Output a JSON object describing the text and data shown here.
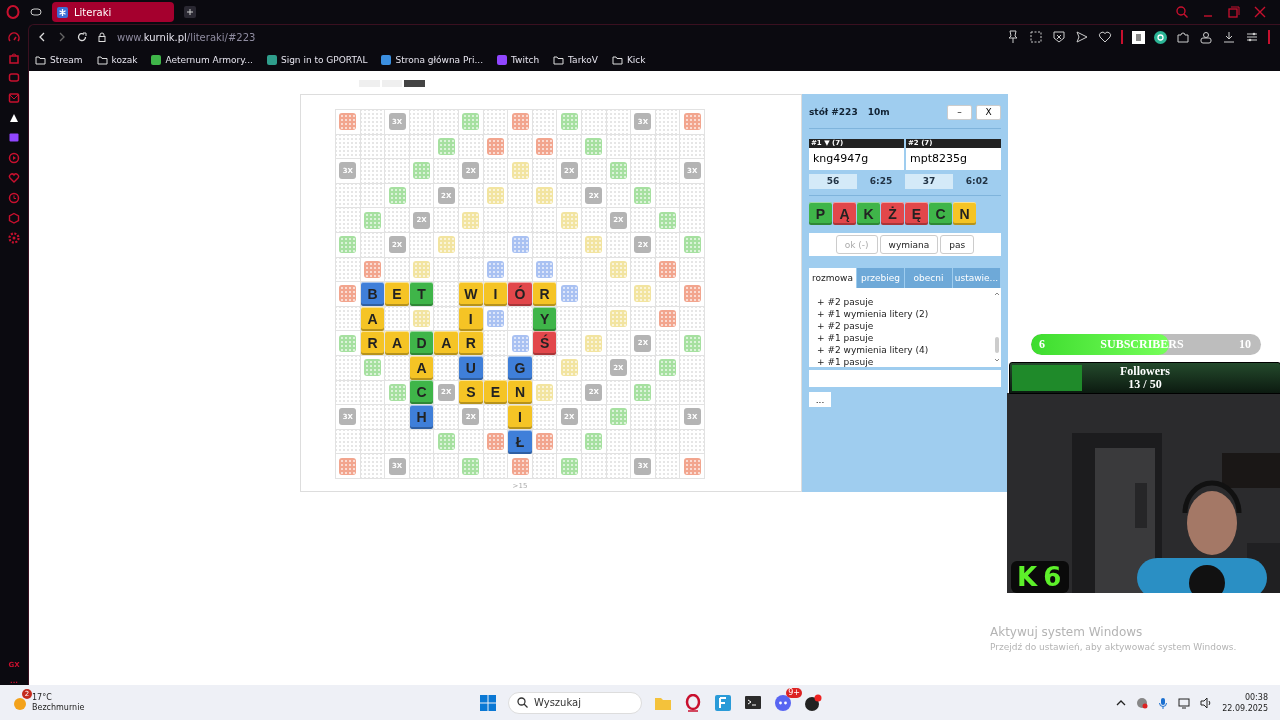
{
  "browser": {
    "tabs": [
      {
        "title": "Literaki",
        "selected": true
      }
    ],
    "url": "www.**kurnik.pl**/literaki/#223",
    "bookmarks": [
      {
        "label": "Stream",
        "kind": "folder"
      },
      {
        "label": "kozak",
        "kind": "folder"
      },
      {
        "label": "Aeternum Armory...",
        "kind": "site",
        "color": "#3fb549"
      },
      {
        "label": "Sign in to GPORTAL",
        "kind": "site",
        "color": "#2f9e8c"
      },
      {
        "label": "Strona główna Pri...",
        "kind": "site",
        "color": "#3b8fe0"
      },
      {
        "label": "Twitch",
        "kind": "site",
        "color": "#9146ff"
      },
      {
        "label": "TarkoV",
        "kind": "folder"
      },
      {
        "label": "Kick",
        "kind": "folder"
      }
    ],
    "sidebar_labels": [
      "GX",
      "..."
    ]
  },
  "game": {
    "pager": [
      {
        "selected": false
      },
      {
        "selected": false
      },
      {
        "selected": true
      }
    ],
    "board": {
      "rows": [
        [
          {
            "kind": "bonus",
            "color": "#f2a58e"
          },
          {
            "kind": "empty"
          },
          {
            "kind": "mult",
            "label": "3X"
          },
          {
            "kind": "empty"
          },
          {
            "kind": "empty"
          },
          {
            "kind": "bonus",
            "color": "#a6e0a0"
          },
          {
            "kind": "empty"
          },
          {
            "kind": "bonus",
            "color": "#f2a58e"
          },
          {
            "kind": "empty"
          },
          {
            "kind": "bonus",
            "color": "#a6e0a0"
          },
          {
            "kind": "empty"
          },
          {
            "kind": "empty"
          },
          {
            "kind": "mult",
            "label": "3X"
          },
          {
            "kind": "empty"
          },
          {
            "kind": "bonus",
            "color": "#f2a58e"
          }
        ],
        [
          {
            "kind": "empty"
          },
          {
            "kind": "empty"
          },
          {
            "kind": "empty"
          },
          {
            "kind": "empty"
          },
          {
            "kind": "bonus",
            "color": "#a6e0a0"
          },
          {
            "kind": "empty"
          },
          {
            "kind": "bonus",
            "color": "#f2a58e"
          },
          {
            "kind": "empty"
          },
          {
            "kind": "bonus",
            "color": "#f2a58e"
          },
          {
            "kind": "empty"
          },
          {
            "kind": "bonus",
            "color": "#a6e0a0"
          },
          {
            "kind": "empty"
          },
          {
            "kind": "empty"
          },
          {
            "kind": "empty"
          },
          {
            "kind": "empty"
          }
        ],
        [
          {
            "kind": "mult",
            "label": "3X"
          },
          {
            "kind": "empty"
          },
          {
            "kind": "empty"
          },
          {
            "kind": "bonus",
            "color": "#a6e0a0"
          },
          {
            "kind": "empty"
          },
          {
            "kind": "mult",
            "label": "2X"
          },
          {
            "kind": "empty"
          },
          {
            "kind": "bonus",
            "color": "#f2e4a0"
          },
          {
            "kind": "empty"
          },
          {
            "kind": "mult",
            "label": "2X"
          },
          {
            "kind": "empty"
          },
          {
            "kind": "bonus",
            "color": "#a6e0a0"
          },
          {
            "kind": "empty"
          },
          {
            "kind": "empty"
          },
          {
            "kind": "mult",
            "label": "3X"
          }
        ],
        [
          {
            "kind": "empty"
          },
          {
            "kind": "empty"
          },
          {
            "kind": "bonus",
            "color": "#a6e0a0"
          },
          {
            "kind": "empty"
          },
          {
            "kind": "mult",
            "label": "2X"
          },
          {
            "kind": "empty"
          },
          {
            "kind": "bonus",
            "color": "#f2e4a0"
          },
          {
            "kind": "empty"
          },
          {
            "kind": "bonus",
            "color": "#f2e4a0"
          },
          {
            "kind": "empty"
          },
          {
            "kind": "mult",
            "label": "2X"
          },
          {
            "kind": "empty"
          },
          {
            "kind": "bonus",
            "color": "#a6e0a0"
          },
          {
            "kind": "empty"
          },
          {
            "kind": "empty"
          }
        ],
        [
          {
            "kind": "empty"
          },
          {
            "kind": "bonus",
            "color": "#a6e0a0"
          },
          {
            "kind": "empty"
          },
          {
            "kind": "mult",
            "label": "2X"
          },
          {
            "kind": "empty"
          },
          {
            "kind": "bonus",
            "color": "#f2e4a0"
          },
          {
            "kind": "empty"
          },
          {
            "kind": "empty"
          },
          {
            "kind": "empty"
          },
          {
            "kind": "bonus",
            "color": "#f2e4a0"
          },
          {
            "kind": "empty"
          },
          {
            "kind": "mult",
            "label": "2X"
          },
          {
            "kind": "empty"
          },
          {
            "kind": "bonus",
            "color": "#a6e0a0"
          },
          {
            "kind": "empty"
          }
        ],
        [
          {
            "kind": "bonus",
            "color": "#a6e0a0"
          },
          {
            "kind": "empty"
          },
          {
            "kind": "mult",
            "label": "2X"
          },
          {
            "kind": "empty"
          },
          {
            "kind": "bonus",
            "color": "#f2e4a0"
          },
          {
            "kind": "empty"
          },
          {
            "kind": "empty"
          },
          {
            "kind": "bonus",
            "color": "#a9c1f2"
          },
          {
            "kind": "empty"
          },
          {
            "kind": "empty"
          },
          {
            "kind": "bonus",
            "color": "#f2e4a0"
          },
          {
            "kind": "empty"
          },
          {
            "kind": "mult",
            "label": "2X"
          },
          {
            "kind": "empty"
          },
          {
            "kind": "bonus",
            "color": "#a6e0a0"
          }
        ],
        [
          {
            "kind": "empty"
          },
          {
            "kind": "bonus",
            "color": "#f2a58e"
          },
          {
            "kind": "empty"
          },
          {
            "kind": "bonus",
            "color": "#f2e4a0"
          },
          {
            "kind": "empty"
          },
          {
            "kind": "empty"
          },
          {
            "kind": "bonus",
            "color": "#a9c1f2"
          },
          {
            "kind": "empty"
          },
          {
            "kind": "bonus",
            "color": "#a9c1f2"
          },
          {
            "kind": "empty"
          },
          {
            "kind": "empty"
          },
          {
            "kind": "bonus",
            "color": "#f2e4a0"
          },
          {
            "kind": "empty"
          },
          {
            "kind": "bonus",
            "color": "#f2a58e"
          },
          {
            "kind": "empty"
          }
        ],
        [
          {
            "kind": "bonus",
            "color": "#f2a58e"
          },
          {
            "kind": "tile",
            "letter": "B",
            "color": "#3f7fd9"
          },
          {
            "kind": "tile",
            "letter": "E",
            "color": "#f5c425"
          },
          {
            "kind": "tile",
            "letter": "T",
            "color": "#3fb549"
          },
          {
            "kind": "empty"
          },
          {
            "kind": "tile",
            "letter": "W",
            "color": "#f5c425"
          },
          {
            "kind": "tile",
            "letter": "I",
            "color": "#f5c425"
          },
          {
            "kind": "tile",
            "letter": "Ó",
            "color": "#e2474b"
          },
          {
            "kind": "tile",
            "letter": "R",
            "color": "#f5c425"
          },
          {
            "kind": "bonus",
            "color": "#a9c1f2"
          },
          {
            "kind": "empty"
          },
          {
            "kind": "empty"
          },
          {
            "kind": "bonus",
            "color": "#f2e4a0"
          },
          {
            "kind": "empty"
          },
          {
            "kind": "bonus",
            "color": "#f2a58e"
          }
        ],
        [
          {
            "kind": "empty"
          },
          {
            "kind": "tile",
            "letter": "A",
            "color": "#f5c425"
          },
          {
            "kind": "empty"
          },
          {
            "kind": "bonus",
            "color": "#f2e4a0"
          },
          {
            "kind": "empty"
          },
          {
            "kind": "tile",
            "letter": "I",
            "color": "#f5c425"
          },
          {
            "kind": "bonus",
            "color": "#a9c1f2"
          },
          {
            "kind": "empty"
          },
          {
            "kind": "tile",
            "letter": "Y",
            "color": "#3fb549"
          },
          {
            "kind": "empty"
          },
          {
            "kind": "empty"
          },
          {
            "kind": "bonus",
            "color": "#f2e4a0"
          },
          {
            "kind": "empty"
          },
          {
            "kind": "bonus",
            "color": "#f2a58e"
          },
          {
            "kind": "empty"
          }
        ],
        [
          {
            "kind": "bonus",
            "color": "#a6e0a0"
          },
          {
            "kind": "tile",
            "letter": "R",
            "color": "#f5c425"
          },
          {
            "kind": "tile",
            "letter": "A",
            "color": "#f5c425"
          },
          {
            "kind": "tile",
            "letter": "D",
            "color": "#3fb549"
          },
          {
            "kind": "tile",
            "letter": "A",
            "color": "#f5c425"
          },
          {
            "kind": "tile",
            "letter": "R",
            "color": "#f5c425"
          },
          {
            "kind": "empty"
          },
          {
            "kind": "bonus",
            "color": "#a9c1f2"
          },
          {
            "kind": "tile",
            "letter": "Ś",
            "color": "#e2474b"
          },
          {
            "kind": "empty"
          },
          {
            "kind": "bonus",
            "color": "#f2e4a0"
          },
          {
            "kind": "empty"
          },
          {
            "kind": "mult",
            "label": "2X"
          },
          {
            "kind": "empty"
          },
          {
            "kind": "bonus",
            "color": "#a6e0a0"
          }
        ],
        [
          {
            "kind": "empty"
          },
          {
            "kind": "bonus",
            "color": "#a6e0a0"
          },
          {
            "kind": "empty"
          },
          {
            "kind": "tile",
            "letter": "A",
            "color": "#f5c425"
          },
          {
            "kind": "empty"
          },
          {
            "kind": "tile",
            "letter": "U",
            "color": "#3f7fd9"
          },
          {
            "kind": "empty"
          },
          {
            "kind": "tile",
            "letter": "G",
            "color": "#3f7fd9"
          },
          {
            "kind": "empty"
          },
          {
            "kind": "bonus",
            "color": "#f2e4a0"
          },
          {
            "kind": "empty"
          },
          {
            "kind": "mult",
            "label": "2X"
          },
          {
            "kind": "empty"
          },
          {
            "kind": "bonus",
            "color": "#a6e0a0"
          },
          {
            "kind": "empty"
          }
        ],
        [
          {
            "kind": "empty"
          },
          {
            "kind": "empty"
          },
          {
            "kind": "bonus",
            "color": "#a6e0a0"
          },
          {
            "kind": "tile",
            "letter": "C",
            "color": "#3fb549"
          },
          {
            "kind": "mult",
            "label": "2X"
          },
          {
            "kind": "tile",
            "letter": "S",
            "color": "#f5c425"
          },
          {
            "kind": "tile",
            "letter": "E",
            "color": "#f5c425"
          },
          {
            "kind": "tile",
            "letter": "N",
            "color": "#f5c425"
          },
          {
            "kind": "bonus",
            "color": "#f2e4a0"
          },
          {
            "kind": "empty"
          },
          {
            "kind": "mult",
            "label": "2X"
          },
          {
            "kind": "empty"
          },
          {
            "kind": "bonus",
            "color": "#a6e0a0"
          },
          {
            "kind": "empty"
          },
          {
            "kind": "empty"
          }
        ],
        [
          {
            "kind": "mult",
            "label": "3X"
          },
          {
            "kind": "empty"
          },
          {
            "kind": "empty"
          },
          {
            "kind": "tile",
            "letter": "H",
            "color": "#3f7fd9"
          },
          {
            "kind": "empty"
          },
          {
            "kind": "mult",
            "label": "2X"
          },
          {
            "kind": "empty"
          },
          {
            "kind": "tile",
            "letter": "I",
            "color": "#f5c425"
          },
          {
            "kind": "empty"
          },
          {
            "kind": "mult",
            "label": "2X"
          },
          {
            "kind": "empty"
          },
          {
            "kind": "bonus",
            "color": "#a6e0a0"
          },
          {
            "kind": "empty"
          },
          {
            "kind": "empty"
          },
          {
            "kind": "mult",
            "label": "3X"
          }
        ],
        [
          {
            "kind": "empty"
          },
          {
            "kind": "empty"
          },
          {
            "kind": "empty"
          },
          {
            "kind": "empty"
          },
          {
            "kind": "bonus",
            "color": "#a6e0a0"
          },
          {
            "kind": "empty"
          },
          {
            "kind": "bonus",
            "color": "#f2a58e"
          },
          {
            "kind": "tile",
            "letter": "Ł",
            "color": "#3f7fd9"
          },
          {
            "kind": "bonus",
            "color": "#f2a58e"
          },
          {
            "kind": "empty"
          },
          {
            "kind": "bonus",
            "color": "#a6e0a0"
          },
          {
            "kind": "empty"
          },
          {
            "kind": "empty"
          },
          {
            "kind": "empty"
          },
          {
            "kind": "empty"
          }
        ],
        [
          {
            "kind": "bonus",
            "color": "#f2a58e"
          },
          {
            "kind": "empty"
          },
          {
            "kind": "mult",
            "label": "3X"
          },
          {
            "kind": "empty"
          },
          {
            "kind": "empty"
          },
          {
            "kind": "bonus",
            "color": "#a6e0a0"
          },
          {
            "kind": "empty"
          },
          {
            "kind": "bonus",
            "color": "#f2a58e"
          },
          {
            "kind": "empty"
          },
          {
            "kind": "bonus",
            "color": "#a6e0a0"
          },
          {
            "kind": "empty"
          },
          {
            "kind": "empty"
          },
          {
            "kind": "mult",
            "label": "3X"
          },
          {
            "kind": "empty"
          },
          {
            "kind": "bonus",
            "color": "#f2a58e"
          }
        ]
      ]
    },
    "board_caption": ">15",
    "table": {
      "title": "stół #223",
      "time_control": "10m",
      "minimize": "–",
      "close": "X"
    },
    "players": [
      {
        "header": "#1 ▼ (7)",
        "name": "kng4947g",
        "score": "56",
        "clock": "6:25"
      },
      {
        "header": "#2 (7)",
        "name": "mpt8235g",
        "score": "37",
        "clock": "6:02"
      }
    ],
    "rack": [
      {
        "letter": "P",
        "color": "#3fb549"
      },
      {
        "letter": "Ą",
        "color": "#e2474b"
      },
      {
        "letter": "K",
        "color": "#3fb549"
      },
      {
        "letter": "Ż",
        "color": "#e2474b"
      },
      {
        "letter": "Ę",
        "color": "#e2474b"
      },
      {
        "letter": "C",
        "color": "#3fb549"
      },
      {
        "letter": "N",
        "color": "#f5c425"
      }
    ],
    "actions": [
      {
        "label": "ok (-)",
        "disabled": true
      },
      {
        "label": "wymiana",
        "disabled": false
      },
      {
        "label": "pas",
        "disabled": false
      }
    ],
    "tabs": [
      {
        "label": "rozmowa",
        "selected": true
      },
      {
        "label": "przebieg",
        "selected": false
      },
      {
        "label": "obecni",
        "selected": false
      },
      {
        "label": "ustawie...",
        "selected": false
      }
    ],
    "log": [
      "+ #2 pasuje",
      "+ #1 wymienia litery (2)",
      "+ #2 pasuje",
      "+ #1 pasuje",
      "+ #2 wymienia litery (4)",
      "+ #1 pasuje"
    ],
    "more_button": "..."
  },
  "stream_overlay": {
    "subscribers": {
      "current": "6",
      "label": "SUBSCRIBERS",
      "goal": "10",
      "level": 0.6
    },
    "followers": {
      "label": "Followers",
      "count": "13 / 50",
      "level": 0.26
    },
    "logo_text": "K6"
  },
  "activation_notice": {
    "title": "Aktywuj system Windows",
    "text": "Przejdź do ustawień, aby aktywować system Windows."
  },
  "taskbar": {
    "weather": {
      "badge": "2",
      "temperature": "17°C",
      "condition": "Bezchmurnie"
    },
    "search_placeholder": "Wyszukaj",
    "discord_badge": "9+",
    "time": "00:38",
    "date": "22.09.2025"
  }
}
